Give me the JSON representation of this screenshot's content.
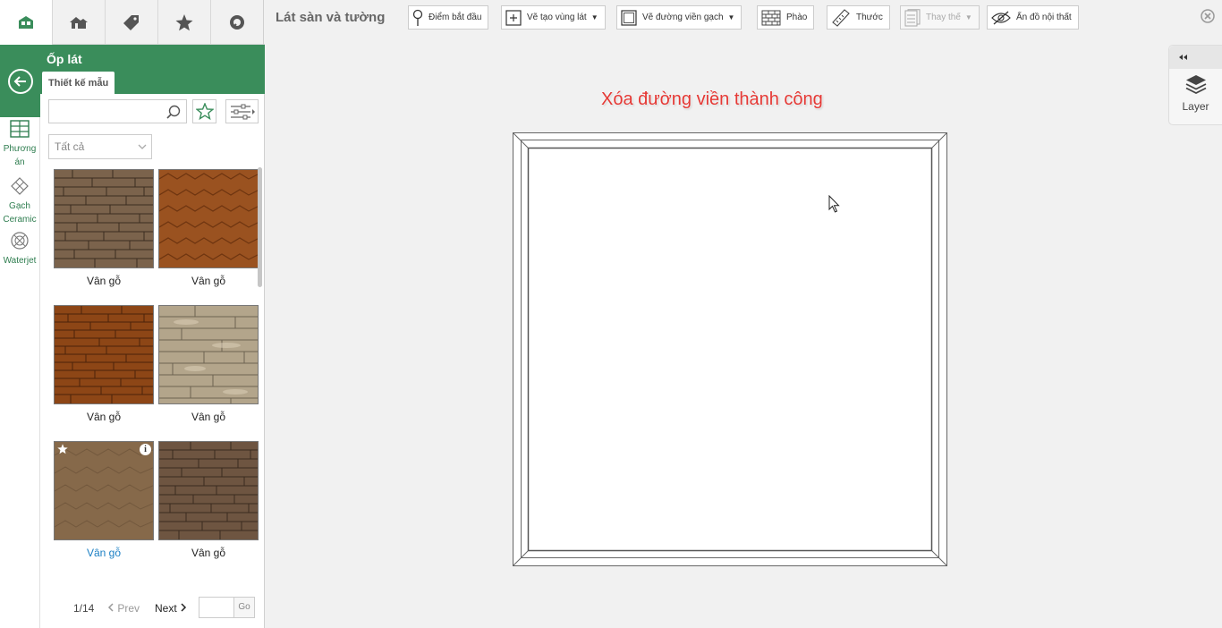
{
  "nav_icons": [
    "app-logo-icon",
    "house-icon",
    "tag-icon",
    "star-icon",
    "search-icon"
  ],
  "panel": {
    "title": "Ốp lát",
    "tab": "Thiết kế mẫu"
  },
  "side_menu": [
    {
      "label": "Phương án",
      "icon": "grid-plan-icon"
    },
    {
      "label": "Gạch Ceramic",
      "icon": "ceramic-tile-icon"
    },
    {
      "label": "Waterjet",
      "icon": "waterjet-icon"
    }
  ],
  "search": {
    "value": "",
    "placeholder": ""
  },
  "filter_select": {
    "value": "Tất cả"
  },
  "products": [
    {
      "name": "Vân gỗ",
      "selected": false,
      "favorite": false
    },
    {
      "name": "Vân gỗ",
      "selected": false,
      "favorite": false
    },
    {
      "name": "Vân gỗ",
      "selected": false,
      "favorite": false
    },
    {
      "name": "Vân gỗ",
      "selected": false,
      "favorite": false
    },
    {
      "name": "Vân gỗ",
      "selected": true,
      "favorite": true
    },
    {
      "name": "Vân gỗ",
      "selected": false,
      "favorite": false
    }
  ],
  "pagination": {
    "page": "1/14",
    "prev": "Prev",
    "next": "Next",
    "go": "Go",
    "input": ""
  },
  "toolbar": {
    "title": "Lát sàn và tường",
    "buttons": [
      {
        "label": "Điểm bắt đầu",
        "icon": "pin-icon"
      },
      {
        "label": "Vẽ tạo vùng lát",
        "icon": "add-area-icon",
        "dropdown": true
      },
      {
        "label": "Vẽ đường viền gạch",
        "icon": "border-icon",
        "dropdown": true
      },
      {
        "label": "Phào",
        "icon": "brick-icon"
      },
      {
        "label": "Thước",
        "icon": "ruler-icon"
      },
      {
        "label": "Thay thế",
        "icon": "replace-icon",
        "dropdown": true,
        "disabled": true
      },
      {
        "label": "Ẩn đồ nội thất",
        "icon": "eye-off-icon"
      }
    ]
  },
  "layer_panel": {
    "label": "Layer"
  },
  "notice": "Xóa đường viền thành công",
  "colors": {
    "brand_green": "#3a8d5b",
    "notice_red": "#e53935",
    "selected_blue": "#1b7fc4"
  }
}
